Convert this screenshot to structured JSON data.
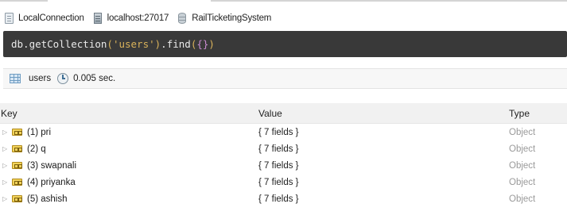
{
  "connection_bar": {
    "connection_name": "LocalConnection",
    "server": "localhost:27017",
    "database": "RailTicketingSystem"
  },
  "query": {
    "prefix": "db.getCollection",
    "open_paren": "(",
    "collection_arg": "'users'",
    "close_paren": ")",
    "method": ".find",
    "method_open": "(",
    "braces": "{}",
    "method_close": ")"
  },
  "result_header": {
    "collection": "users",
    "elapsed": "0.005 sec."
  },
  "table": {
    "columns": [
      "Key",
      "Value",
      "Type"
    ],
    "rows": [
      {
        "key": "(1) pri",
        "value": "{ 7 fields }",
        "type": "Object"
      },
      {
        "key": "(2) q",
        "value": "{ 7 fields }",
        "type": "Object"
      },
      {
        "key": "(3) swapnali",
        "value": "{ 7 fields }",
        "type": "Object"
      },
      {
        "key": "(4) priyanka",
        "value": "{ 7 fields }",
        "type": "Object"
      },
      {
        "key": "(5) ashish",
        "value": "{ 7 fields }",
        "type": "Object"
      }
    ]
  },
  "icons": {
    "connection": "computer-file-icon",
    "server": "server-icon",
    "database": "database-icon",
    "collection": "table-grid-icon",
    "elapsed": "clock-icon",
    "row_expander": "triangle-right-icon",
    "document": "document-object-icon"
  },
  "colors": {
    "query_background": "#393939",
    "query_text": "#eaeaea",
    "query_string": "#d9b25a",
    "query_braces": "#c98bd1",
    "type_text": "#9a9a9a"
  }
}
